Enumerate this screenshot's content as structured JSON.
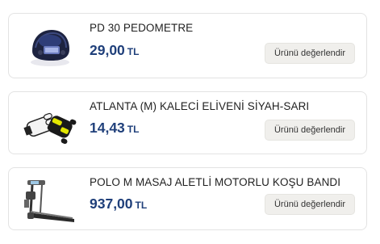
{
  "products": [
    {
      "name": "PD 30 PEDOMETRE",
      "price": "29,00",
      "currency": "TL",
      "review_button": "Ürünü değerlendir",
      "image_icon": "pedometer-image"
    },
    {
      "name": "ATLANTA (M) KALECİ ELİVENİ SİYAH-SARI",
      "price": "14,43",
      "currency": "TL",
      "review_button": "Ürünü değerlendir",
      "image_icon": "goalkeeper-glove-image"
    },
    {
      "name": "POLO M MASAJ ALETLİ MOTORLU KOŞU BANDI",
      "price": "937,00",
      "currency": "TL",
      "review_button": "Ürünü değerlendir",
      "image_icon": "treadmill-image"
    }
  ],
  "colors": {
    "price": "#1f3f7a",
    "button_bg": "#f0efec",
    "card_border": "#e3e3e3"
  }
}
